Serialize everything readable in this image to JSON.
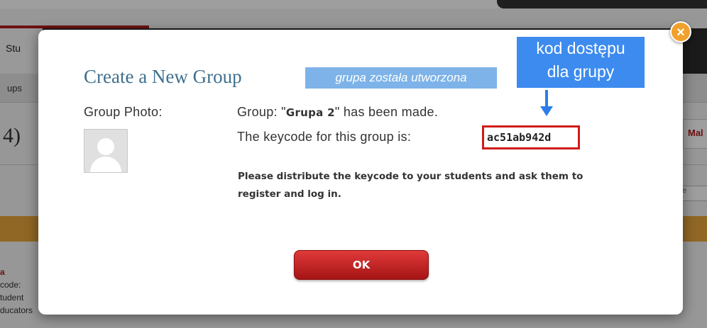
{
  "background": {
    "nav_tab": "Stu",
    "subnav_text": "ups",
    "page_title_fragment": "4)",
    "right_tab_label": "Mal",
    "right_input_text": "e",
    "list_lines": [
      "a",
      "code:",
      "tudent",
      "ducators"
    ]
  },
  "modal": {
    "title": "Create a New Group",
    "photo_label": "Group Photo:",
    "made_prefix": "Group: \"",
    "group_name": "Grupa 2",
    "made_suffix": "\" has been made.",
    "keycode_label": "The keycode for this group is:",
    "keycode": "ac51ab942d",
    "instructions": "Please distribute the keycode to your students and ask them to register and log in.",
    "ok_label": "OK",
    "close_glyph": "×"
  },
  "annotations": {
    "created_note": "grupa została utworzona",
    "callout_line1": "kod dostępu",
    "callout_line2": "dla grupy"
  },
  "colors": {
    "title": "#3f6f8f",
    "ok_button": "#c42222",
    "close_button": "#f0a12c",
    "keycode_highlight": "#d01b1b",
    "annotation_blue": "#3d8bef"
  }
}
